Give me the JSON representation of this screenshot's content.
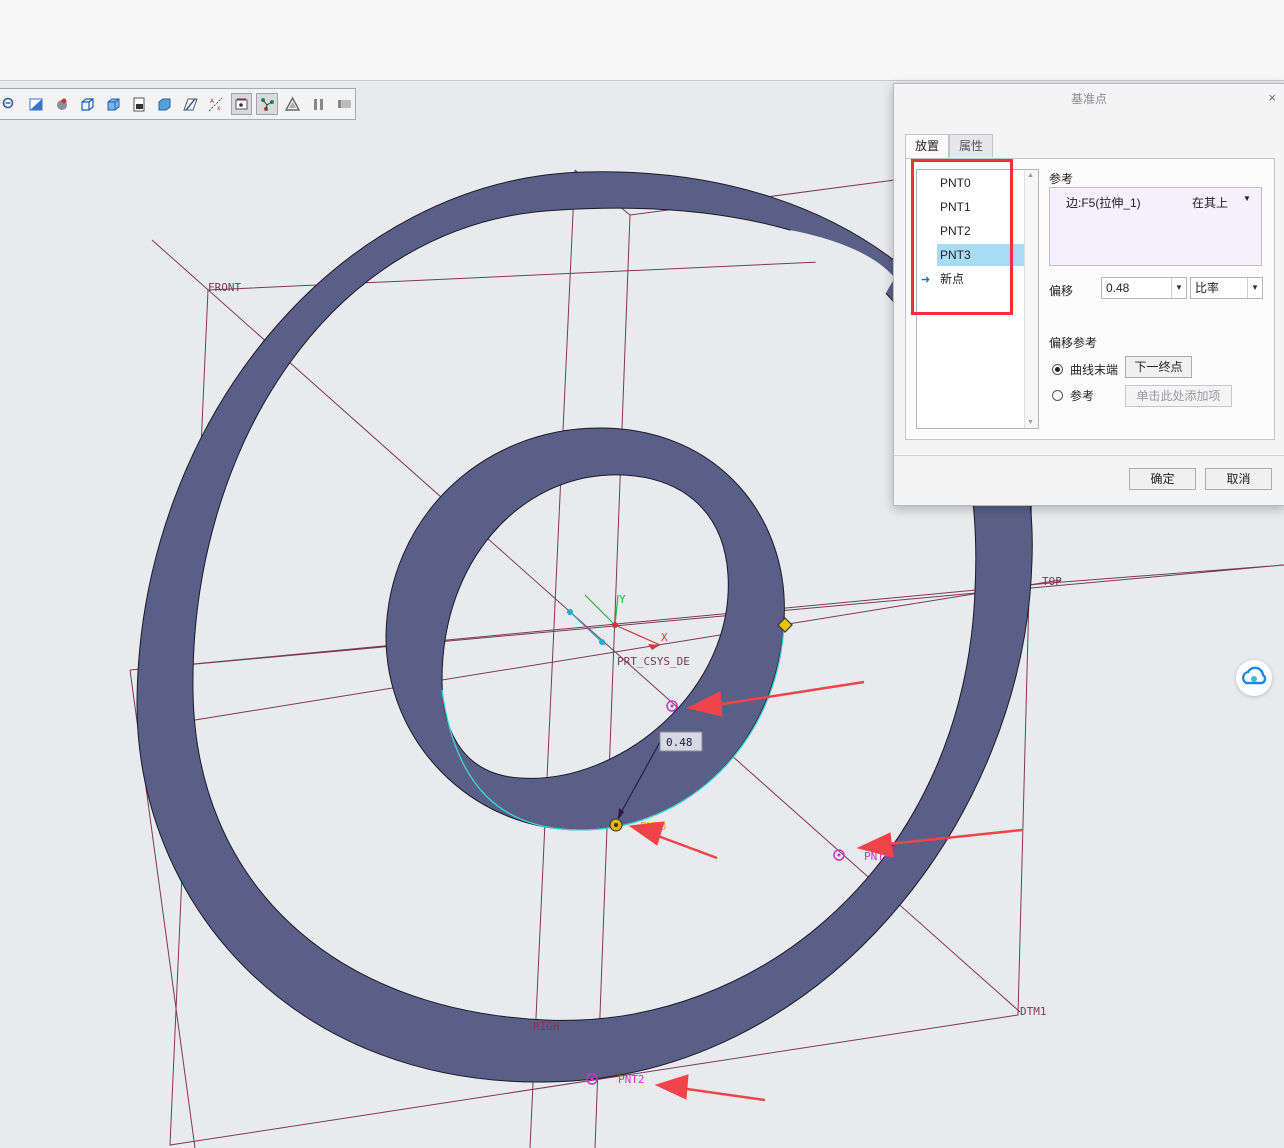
{
  "toolbar": {
    "icons": [
      "zoom-out-icon",
      "repaint-icon",
      "shading-icon",
      "wireframe-icon",
      "hidden-line-icon",
      "saved-views-icon",
      "view-manager-icon",
      "datum-plane-display-icon",
      "datum-axis-display-icon",
      "datum-point-display-icon",
      "csys-display-icon",
      "annotation-display-icon",
      "pause-icon",
      "spin-center-icon"
    ]
  },
  "viewport": {
    "labels": {
      "front": "FRONT",
      "top": "TOP",
      "right": "RIGH",
      "dtm1": "DTM1",
      "csys": "PRT_CSYS_DE",
      "x_axis": "X",
      "y_axis": "Y",
      "pnt0": "PNT0",
      "pnt2": "PNT2",
      "pnt3": "PNT3",
      "dimension": "0.48"
    },
    "colors": {
      "surface": "#5a5f87",
      "datum": "#7a3b4e",
      "point": "#c238c8",
      "active_point": "#e6b400",
      "arrow": "#f0444a"
    }
  },
  "dialog": {
    "title": "基准点",
    "close": "×",
    "tabs": [
      "放置",
      "属性"
    ],
    "points": [
      "PNT0",
      "PNT1",
      "PNT2",
      "PNT3"
    ],
    "selected_point": "PNT3",
    "new_point": "新点",
    "reference_label": "参考",
    "reference_value": "边:F5(拉伸_1)",
    "reference_constraint": "在其上",
    "offset_label": "偏移",
    "offset_value": "0.48",
    "offset_type": "比率",
    "offset_ref_label": "偏移参考",
    "radio_curve_end": "曲线末端",
    "next_end_button": "下一终点",
    "radio_reference": "参考",
    "add_item_placeholder": "单击此处添加项",
    "ok": "确定",
    "cancel": "取消"
  }
}
